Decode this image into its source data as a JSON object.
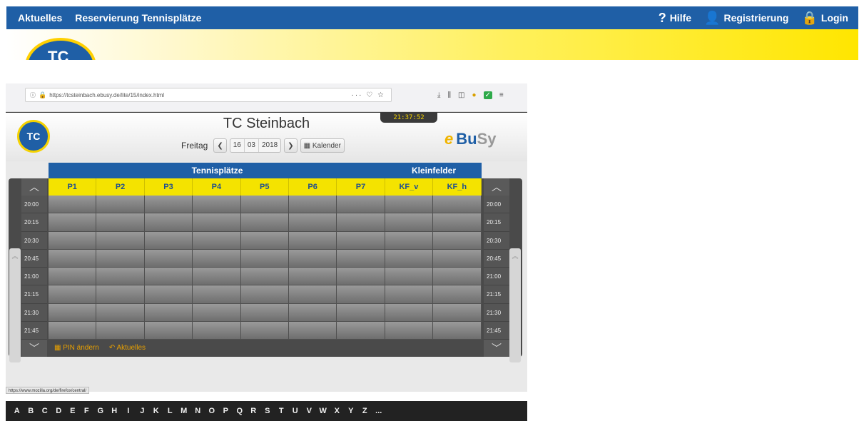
{
  "site": {
    "nav_left": [
      "Aktuelles",
      "Reservierung Tennisplätze"
    ],
    "help": "Hilfe",
    "register": "Registrierung",
    "login": "Login",
    "banner_logo_text": "TC"
  },
  "browser": {
    "url": "https://tcsteinbach.ebusy.de/lite/15/index.html",
    "url_tail": "··· ♡ ☆",
    "status_url": "https://www.mozilla.org/de/firefox/central/"
  },
  "app": {
    "logo_text": "TC",
    "title": "TC Steinbach",
    "clock": "21:37:52",
    "weekday": "Freitag",
    "day": "16",
    "month": "03",
    "year": "2018",
    "calendar_label": "Kalender",
    "brand_e": "e",
    "brand_bu": "Bu",
    "brand_sy": "Sy",
    "groups": [
      {
        "label": "Tennisplätze"
      },
      {
        "label": "Kleinfelder"
      }
    ],
    "courts": [
      "P1",
      "P2",
      "P3",
      "P4",
      "P5",
      "P6",
      "P7",
      "KF_v",
      "KF_h"
    ],
    "times": [
      "20:00",
      "20:15",
      "20:30",
      "20:45",
      "21:00",
      "21:15",
      "21:30",
      "21:45"
    ],
    "pin_label": "PIN ändern",
    "news_label": "Aktuelles",
    "alphabet": [
      "A",
      "B",
      "C",
      "D",
      "E",
      "F",
      "G",
      "H",
      "I",
      "J",
      "K",
      "L",
      "M",
      "N",
      "O",
      "P",
      "Q",
      "R",
      "S",
      "T",
      "U",
      "V",
      "W",
      "X",
      "Y",
      "Z",
      "..."
    ]
  }
}
